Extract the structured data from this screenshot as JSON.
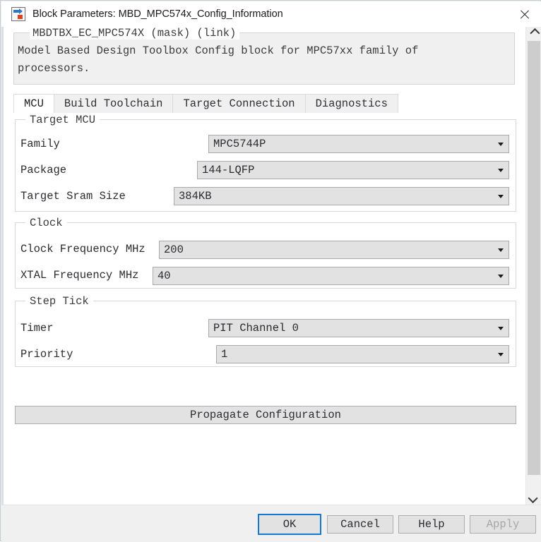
{
  "window": {
    "title": "Block Parameters: MBD_MPC574x_Config_Information",
    "icon": "simulink-block-icon",
    "close_icon": "close-icon"
  },
  "description": {
    "legend": "MBDTBX_EC_MPC574X (mask) (link)",
    "line1": "Model Based Design Toolbox Config block for MPC57xx family of",
    "line2": "processors."
  },
  "tabs": [
    {
      "label": "MCU",
      "active": true
    },
    {
      "label": "Build Toolchain",
      "active": false
    },
    {
      "label": "Target Connection",
      "active": false
    },
    {
      "label": "Diagnostics",
      "active": false
    }
  ],
  "groups": {
    "target_mcu": {
      "legend": "Target MCU",
      "fields": [
        {
          "label": "Family",
          "value": "MPC5744P"
        },
        {
          "label": "Package",
          "value": "144-LQFP"
        },
        {
          "label": "Target Sram Size",
          "value": "384KB"
        }
      ]
    },
    "clock": {
      "legend": "Clock",
      "fields": [
        {
          "label": "Clock Frequency MHz",
          "value": "200"
        },
        {
          "label": "XTAL Frequency MHz",
          "value": "40"
        }
      ]
    },
    "step_tick": {
      "legend": "Step Tick",
      "fields": [
        {
          "label": "Timer",
          "value": "PIT Channel 0"
        },
        {
          "label": "Priority",
          "value": "1"
        }
      ]
    }
  },
  "propagate_button": {
    "label": "Propagate Configuration"
  },
  "scrollbar": {
    "up_icon": "chevron-up-icon",
    "down_icon": "chevron-down-icon"
  },
  "footer": {
    "ok": "OK",
    "cancel": "Cancel",
    "help": "Help",
    "apply": "Apply"
  },
  "colors": {
    "focus_border": "#1477d1",
    "field_bg": "#e2e2e2",
    "window_bg": "#f0f0f0",
    "disabled_text": "#a6a6a6"
  }
}
